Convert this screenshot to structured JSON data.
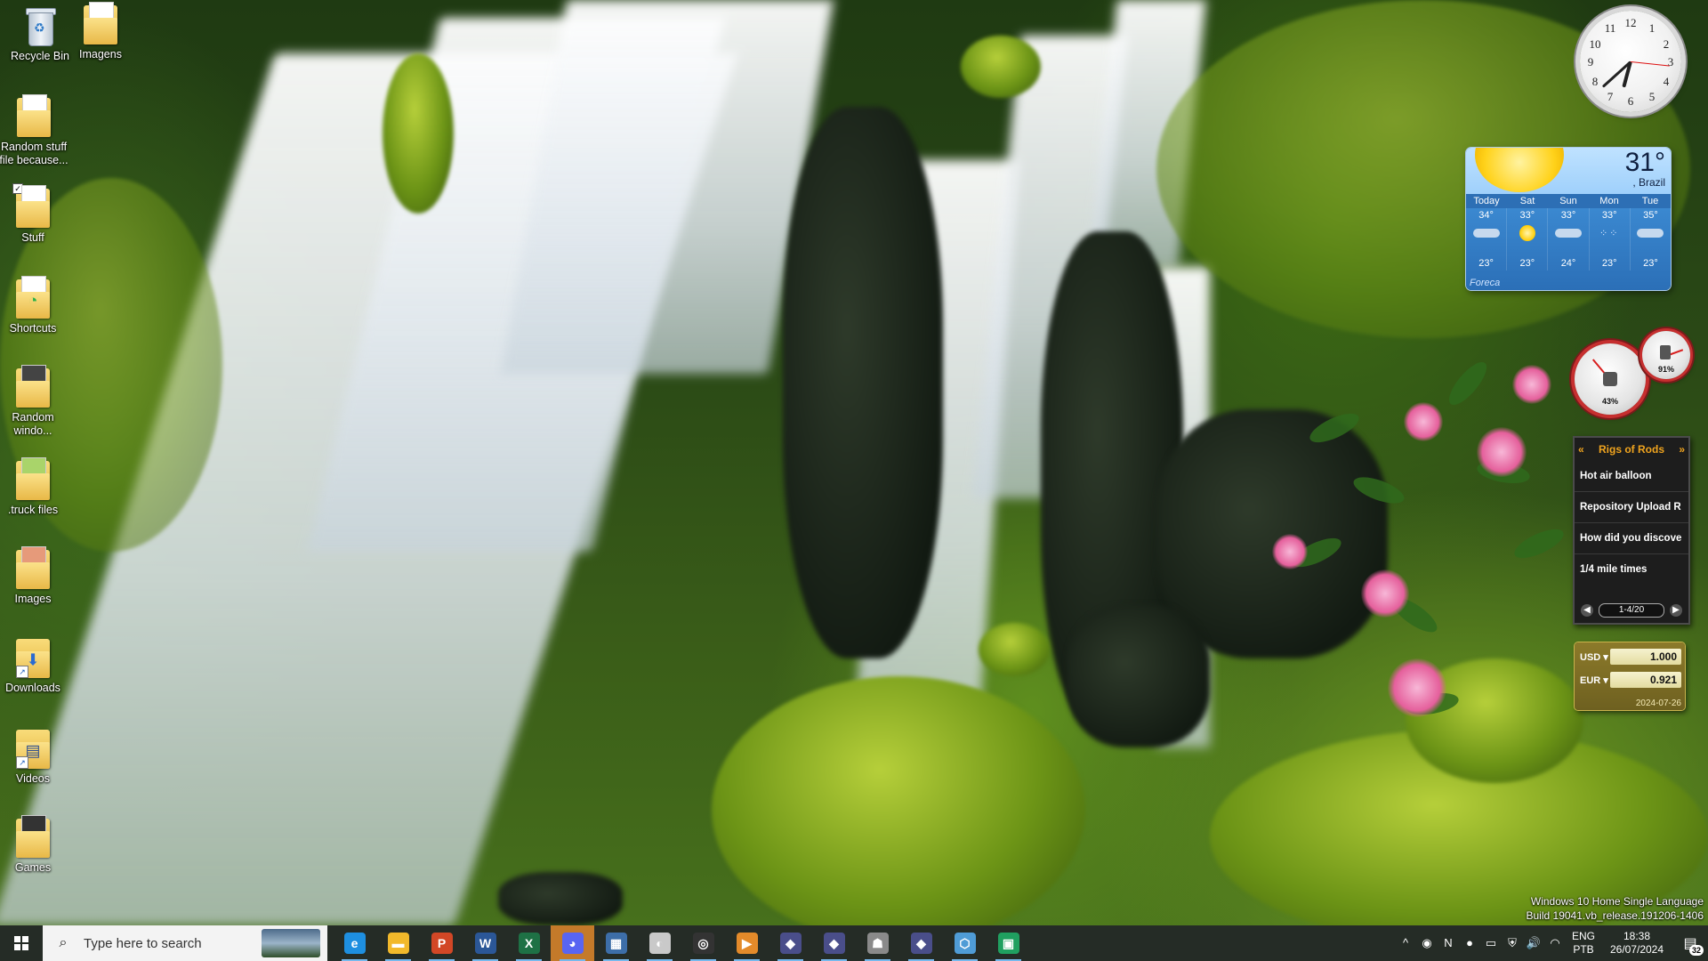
{
  "desktop": {
    "icons": [
      {
        "label": "Recycle Bin"
      },
      {
        "label": "Imagens"
      },
      {
        "label": "Random stuff file because..."
      },
      {
        "label": "Stuff"
      },
      {
        "label": "Shortcuts"
      },
      {
        "label": "Random windo..."
      },
      {
        "label": ".truck files"
      },
      {
        "label": "Images"
      },
      {
        "label": "Downloads"
      },
      {
        "label": "Videos"
      },
      {
        "label": "Games"
      }
    ]
  },
  "clock_gadget": {
    "numbers": [
      "12",
      "1",
      "2",
      "3",
      "4",
      "5",
      "6",
      "7",
      "8",
      "9",
      "10",
      "11"
    ],
    "time": "18:38"
  },
  "weather_gadget": {
    "temperature": "31°",
    "location": ", Brazil",
    "days": [
      "Today",
      "Sat",
      "Sun",
      "Mon",
      "Tue"
    ],
    "forecast": [
      {
        "high": "34°",
        "low": "23°",
        "condition": "cloudy"
      },
      {
        "high": "33°",
        "low": "23°",
        "condition": "sunny"
      },
      {
        "high": "33°",
        "low": "24°",
        "condition": "cloudy"
      },
      {
        "high": "33°",
        "low": "23°",
        "condition": "rain"
      },
      {
        "high": "35°",
        "low": "23°",
        "condition": "cloudy"
      }
    ],
    "source": "Foreca"
  },
  "cpu_meter": {
    "cpu_percent": "43%",
    "memory_percent": "91%"
  },
  "feed_gadget": {
    "title": "Rigs of Rods",
    "prev_arrow": "«",
    "next_arrow": "»",
    "items": [
      {
        "text": "Hot air balloon"
      },
      {
        "text": "Repository Upload R"
      },
      {
        "text": "How did you discove"
      },
      {
        "text": "1/4 mile times"
      }
    ],
    "pager": "1-4/20"
  },
  "currency_gadget": {
    "rows": [
      {
        "code": "USD",
        "value": "1.000"
      },
      {
        "code": "EUR",
        "value": "0.921"
      }
    ],
    "date": "2024-07-26"
  },
  "watermark": {
    "line1": "Windows 10 Home Single Language",
    "line2": "Build 19041.vb_release.191206-1406"
  },
  "taskbar": {
    "search_placeholder": "Type here to search",
    "apps": [
      {
        "name": "internet-explorer-icon",
        "glyph": "e",
        "color": "#1e8fe0"
      },
      {
        "name": "file-explorer-icon",
        "glyph": "▬",
        "color": "#f2b92b"
      },
      {
        "name": "powerpoint-icon",
        "glyph": "P",
        "color": "#d24726"
      },
      {
        "name": "word-icon",
        "glyph": "W",
        "color": "#2b5797"
      },
      {
        "name": "excel-icon",
        "glyph": "X",
        "color": "#1e7145"
      },
      {
        "name": "discord-icon",
        "glyph": "◕",
        "color": "#5865f2",
        "active": true
      },
      {
        "name": "app-7-icon",
        "glyph": "▦",
        "color": "#3d6ea8"
      },
      {
        "name": "app-8-icon",
        "glyph": "◐",
        "color": "#c9c9c9"
      },
      {
        "name": "steam-like-icon",
        "glyph": "◎",
        "color": "#333333"
      },
      {
        "name": "media-player-icon",
        "glyph": "▶",
        "color": "#e38a2a"
      },
      {
        "name": "app-11-icon",
        "glyph": "◆",
        "color": "#4a4e8a"
      },
      {
        "name": "app-12-icon",
        "glyph": "◆",
        "color": "#4a4e8a"
      },
      {
        "name": "app-13-icon",
        "glyph": "☗",
        "color": "#8a8a8a"
      },
      {
        "name": "app-14-icon",
        "glyph": "◆",
        "color": "#4a4e8a"
      },
      {
        "name": "app-15-icon",
        "glyph": "⬡",
        "color": "#4f9cd6"
      },
      {
        "name": "app-16-icon",
        "glyph": "▣",
        "color": "#20a060"
      }
    ],
    "tray_icons": [
      {
        "name": "show-hidden-icon",
        "glyph": "^"
      },
      {
        "name": "steam-tray-icon",
        "glyph": "◉"
      },
      {
        "name": "onenote-tray-icon",
        "glyph": "N"
      },
      {
        "name": "orange-tray-icon",
        "glyph": "●"
      },
      {
        "name": "battery-icon",
        "glyph": "▭"
      },
      {
        "name": "defender-icon",
        "glyph": "⛨"
      },
      {
        "name": "volume-icon",
        "glyph": "🔊"
      },
      {
        "name": "wifi-icon",
        "glyph": "◠"
      }
    ],
    "language_top": "ENG",
    "language_bottom": "PTB",
    "time": "18:38",
    "date": "26/07/2024",
    "notification_count": "32"
  },
  "colors": {
    "taskbar_bg": "#141c16",
    "active_app": "#c47a2a",
    "feed_accent": "#f0a41e"
  }
}
